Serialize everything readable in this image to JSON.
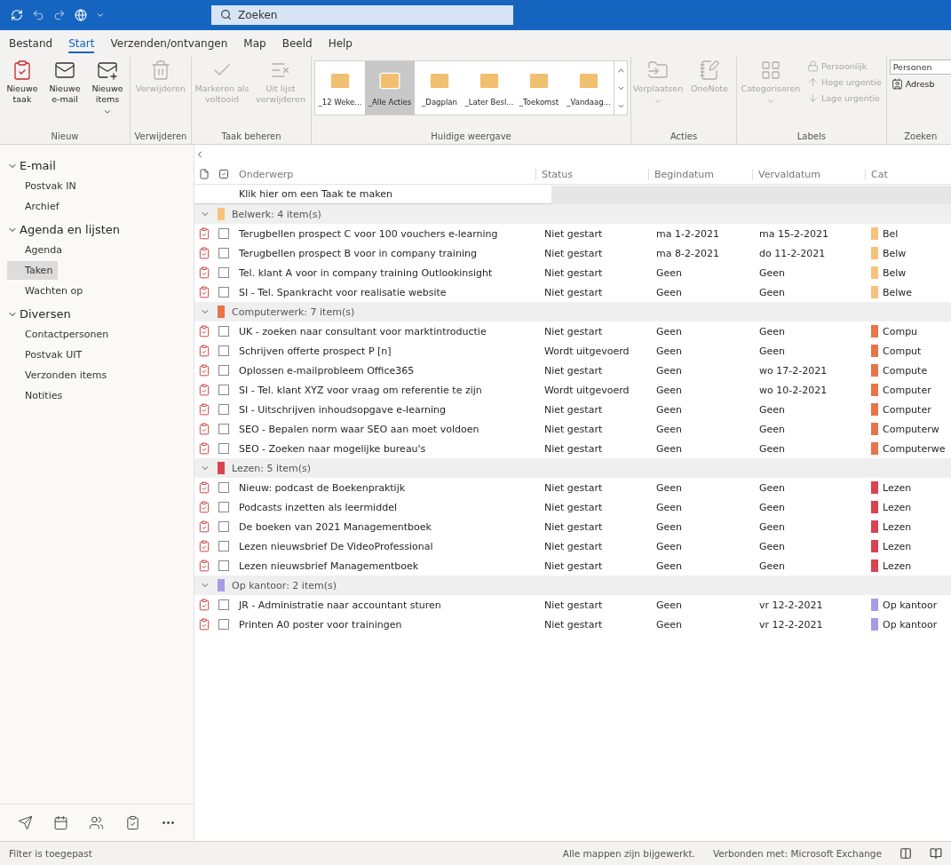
{
  "title_bar": {
    "search_placeholder": "Zoeken"
  },
  "ribbon_tabs": [
    {
      "label": "Bestand",
      "selected": false
    },
    {
      "label": "Start",
      "selected": true
    },
    {
      "label": "Verzenden/ontvangen",
      "selected": false
    },
    {
      "label": "Map",
      "selected": false
    },
    {
      "label": "Beeld",
      "selected": false
    },
    {
      "label": "Help",
      "selected": false
    }
  ],
  "ribbon_groups": [
    {
      "title": "Nieuw",
      "buttons": [
        {
          "label": "Nieuwe taak",
          "disabled": false,
          "dropdown": false
        },
        {
          "label": "Nieuwe e-mail",
          "disabled": false,
          "dropdown": false
        },
        {
          "label": "Nieuwe items",
          "disabled": false,
          "dropdown": true
        }
      ]
    },
    {
      "title": "Verwijderen",
      "buttons": [
        {
          "label": "Verwijderen",
          "disabled": true,
          "dropdown": false
        }
      ]
    },
    {
      "title": "Taak beheren",
      "buttons": [
        {
          "label": "Markeren als voltooid",
          "disabled": true,
          "dropdown": false
        },
        {
          "label": "Uit lijst verwijderen",
          "disabled": true,
          "dropdown": false
        }
      ]
    },
    {
      "title": "Huidige weergave",
      "gallery": [
        {
          "label": "_12 Weke...",
          "selected": false
        },
        {
          "label": "_Alle Acties",
          "selected": true
        },
        {
          "label": "_Dagplan",
          "selected": false
        },
        {
          "label": "_Later Besl...",
          "selected": false
        },
        {
          "label": "_Toekomst",
          "selected": false
        },
        {
          "label": "_Vandaag...",
          "selected": false
        }
      ]
    },
    {
      "title": "Acties",
      "buttons": [
        {
          "label": "Verplaatsen",
          "disabled": true,
          "dropdown": true
        },
        {
          "label": "OneNote",
          "disabled": true,
          "dropdown": false
        }
      ]
    },
    {
      "title": "Labels",
      "buttons": [
        {
          "label": "Categoriseren",
          "disabled": true,
          "dropdown": true
        }
      ],
      "small_buttons": [
        {
          "label": "Persoonlijk",
          "disabled": true
        },
        {
          "label": "Hoge urgentie",
          "disabled": true
        },
        {
          "label": "Lage urgentie",
          "disabled": true
        }
      ]
    },
    {
      "title": "Zoeken",
      "search_field": {
        "placeholder": "Personen"
      },
      "small_buttons": [
        {
          "label": "Adresb",
          "disabled": false
        }
      ]
    }
  ],
  "folder_groups": [
    {
      "label": "E-mail",
      "expanded": true,
      "items": [
        {
          "label": "Postvak IN",
          "selected": false
        },
        {
          "label": "Archief",
          "selected": false
        }
      ]
    },
    {
      "label": "Agenda en lijsten",
      "expanded": true,
      "items": [
        {
          "label": "Agenda",
          "selected": false
        },
        {
          "label": "Taken",
          "selected": true
        },
        {
          "label": "Wachten op",
          "selected": false
        }
      ]
    },
    {
      "label": "Diversen",
      "expanded": true,
      "items": [
        {
          "label": "Contactpersonen",
          "selected": false
        },
        {
          "label": "Postvak UIT",
          "selected": false
        },
        {
          "label": "Verzonden items",
          "selected": false
        },
        {
          "label": "Notities",
          "selected": false
        }
      ]
    }
  ],
  "table": {
    "columns": [
      "Onderwerp",
      "Status",
      "Begindatum",
      "Vervaldatum",
      "Cat"
    ],
    "new_row_hint": "Klik hier om een Taak te maken",
    "groups": [
      {
        "label": "Belwerk: 4 item(s)",
        "color": "#f7c27a",
        "expanded": true,
        "rows": [
          {
            "subject": "Terugbellen prospect C voor 100 vouchers e-learning",
            "complete": false,
            "status": "Niet gestart",
            "start": "ma 1-2-2021",
            "due": "ma 15-2-2021",
            "category": "Bel"
          },
          {
            "subject": "Terugbellen prospect B voor in company training",
            "complete": false,
            "status": "Niet gestart",
            "start": "ma 8-2-2021",
            "due": "do 11-2-2021",
            "category": "Belw"
          },
          {
            "subject": "Tel. klant A voor in company training Outlookinsight",
            "complete": false,
            "status": "Niet gestart",
            "start": "Geen",
            "due": "Geen",
            "category": "Belw"
          },
          {
            "subject": "SI - Tel. Spankracht voor realisatie website",
            "complete": false,
            "status": "Niet gestart",
            "start": "Geen",
            "due": "Geen",
            "category": "Belwe"
          }
        ]
      },
      {
        "label": "Computerwerk: 7 item(s)",
        "color": "#e8744a",
        "expanded": true,
        "rows": [
          {
            "subject": "UK - zoeken naar consultant voor marktintroductie",
            "complete": false,
            "status": "Niet gestart",
            "start": "Geen",
            "due": "Geen",
            "category": "Compu"
          },
          {
            "subject": "Schrijven offerte prospect P [n]",
            "complete": false,
            "status": "Wordt uitgevoerd",
            "start": "Geen",
            "due": "Geen",
            "category": "Comput"
          },
          {
            "subject": "Oplossen e-mailprobleem Office365",
            "complete": false,
            "status": "Niet gestart",
            "start": "Geen",
            "due": "wo 17-2-2021",
            "category": "Compute"
          },
          {
            "subject": "SI - Tel. klant XYZ voor vraag om referentie te zijn",
            "complete": false,
            "status": "Wordt uitgevoerd",
            "start": "Geen",
            "due": "wo 10-2-2021",
            "category": "Computer"
          },
          {
            "subject": "SI - Uitschrijven inhoudsopgave e-learning",
            "complete": false,
            "status": "Niet gestart",
            "start": "Geen",
            "due": "Geen",
            "category": "Computer"
          },
          {
            "subject": "SEO - Bepalen norm waar SEO aan moet voldoen",
            "complete": false,
            "status": "Niet gestart",
            "start": "Geen",
            "due": "Geen",
            "category": "Computerw"
          },
          {
            "subject": "SEO - Zoeken naar mogelijke bureau's",
            "complete": false,
            "status": "Niet gestart",
            "start": "Geen",
            "due": "Geen",
            "category": "Computerwe"
          }
        ]
      },
      {
        "label": "Lezen: 5 item(s)",
        "color": "#d9434f",
        "expanded": true,
        "rows": [
          {
            "subject": "Nieuw: podcast de Boekenpraktijk",
            "complete": false,
            "status": "Niet gestart",
            "start": "Geen",
            "due": "Geen",
            "category": "Lezen"
          },
          {
            "subject": "Podcasts inzetten als leermiddel",
            "complete": false,
            "status": "Niet gestart",
            "start": "Geen",
            "due": "Geen",
            "category": "Lezen"
          },
          {
            "subject": "De boeken van 2021 Managementboek",
            "complete": false,
            "status": "Niet gestart",
            "start": "Geen",
            "due": "Geen",
            "category": "Lezen"
          },
          {
            "subject": "Lezen nieuwsbrief De VideoProfessional",
            "complete": false,
            "status": "Niet gestart",
            "start": "Geen",
            "due": "Geen",
            "category": "Lezen"
          },
          {
            "subject": "Lezen nieuwsbrief Managementboek",
            "complete": false,
            "status": "Niet gestart",
            "start": "Geen",
            "due": "Geen",
            "category": "Lezen"
          }
        ]
      },
      {
        "label": "Op kantoor: 2 item(s)",
        "color": "#a99be6",
        "expanded": true,
        "rows": [
          {
            "subject": "JR - Administratie naar accountant sturen",
            "complete": false,
            "status": "Niet gestart",
            "start": "Geen",
            "due": "vr 12-2-2021",
            "category": "Op kantoor"
          },
          {
            "subject": "Printen A0 poster voor trainingen",
            "complete": false,
            "status": "Niet gestart",
            "start": "Geen",
            "due": "vr 12-2-2021",
            "category": "Op kantoor"
          }
        ]
      }
    ]
  },
  "status_bar": {
    "filter_notice": "Filter is toegepast",
    "messages": [
      "Alle mappen zijn bijgewerkt.",
      "Verbonden met: Microsoft Exchange"
    ]
  }
}
